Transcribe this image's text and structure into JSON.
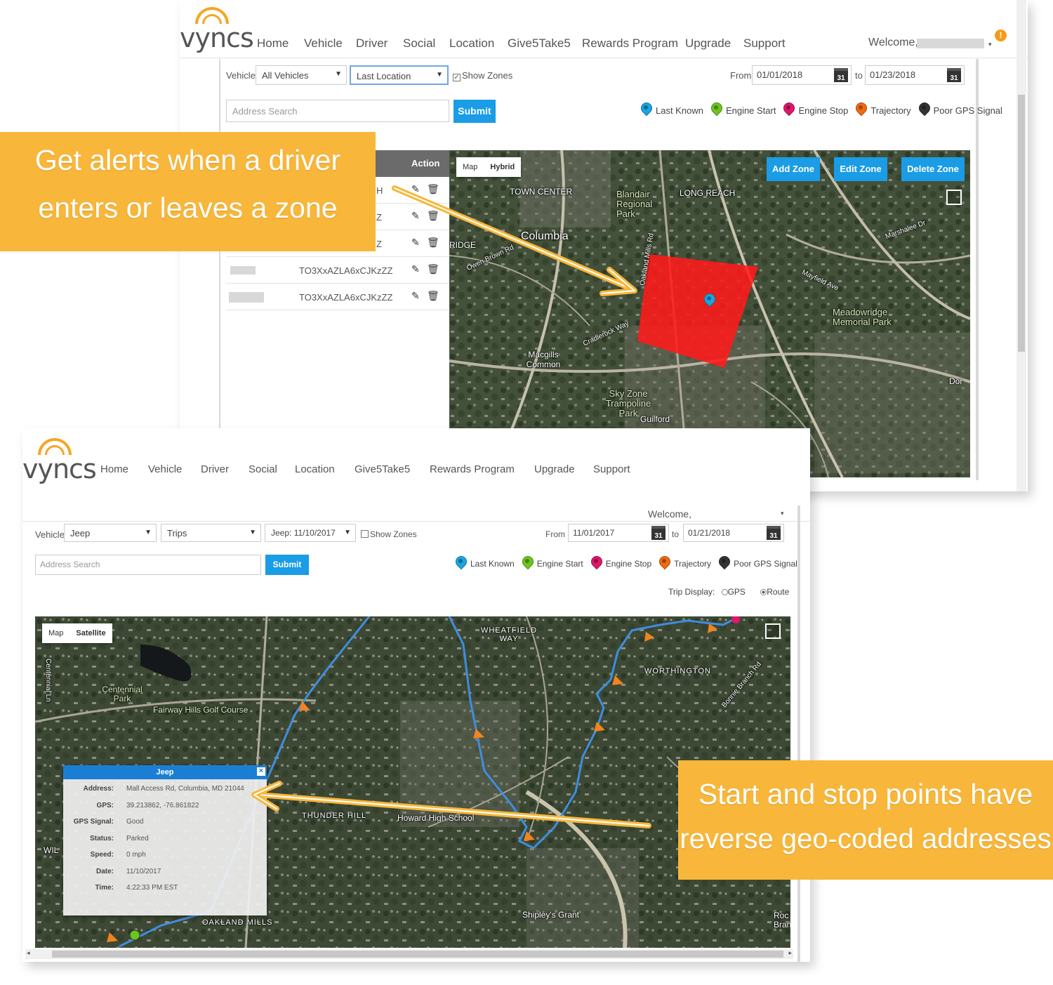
{
  "brand": {
    "logo_text": "vyncs",
    "accent": "#f5a623"
  },
  "nav": [
    "Home",
    "Vehicle",
    "Driver",
    "Social",
    "Location",
    "Give5Take5",
    "Rewards Program",
    "Upgrade",
    "Support"
  ],
  "screen1": {
    "welcome": "Welcome,",
    "notification_badge": "!",
    "vehicle_label": "Vehicle",
    "vehicle_select": "All Vehicles",
    "mode_select": "Last Location",
    "show_zones": "Show Zones",
    "from_label": "From",
    "from_date": "01/01/2018",
    "to_label": "to",
    "to_date": "01/23/2018",
    "cal_text": "31",
    "address_placeholder": "Address Search",
    "submit": "Submit",
    "legend": [
      {
        "label": "Last Known",
        "color": "#1aa5e0"
      },
      {
        "label": "Engine Start",
        "color": "#6cc51e"
      },
      {
        "label": "Engine Stop",
        "color": "#e0166b"
      },
      {
        "label": "Trajectory",
        "color": "#f26a10"
      },
      {
        "label": "Poor GPS Signal",
        "color": "#333333"
      }
    ],
    "table_action_header": "Action",
    "rows": [
      {
        "code": "TO3XxAZLA6xCJKzZZ"
      },
      {
        "code": "TO3XxAZLA6xCJKzZZ"
      }
    ],
    "row_fragments": [
      "H",
      "Z",
      "Z"
    ],
    "map_types": [
      "Map",
      "Hybrid"
    ],
    "zone_buttons": [
      "Add Zone",
      "Edit Zone",
      "Delete Zone"
    ],
    "map_labels": [
      "TOWN CENTER",
      "Columbia",
      "Blandair Regional Park",
      "LONG REACH",
      "RIDGE",
      "Macgills Common",
      "Sky Zone Trampoline Park",
      "Guilford",
      "Meadowridge Memorial Park",
      "Cradlerock Way",
      "Owen Brown Rd",
      "Oakland Mills Rd",
      "Marshalee Dr",
      "Mayfield Ave",
      "Dor"
    ]
  },
  "screen2": {
    "welcome": "Welcome,",
    "vehicle_label": "Vehicle",
    "vehicle_select": "Jeep",
    "mode_select": "Trips",
    "trip_select": "Jeep: 11/10/2017",
    "show_zones": "Show Zones",
    "from_label": "From",
    "from_date": "11/01/2017",
    "to_label": "to",
    "to_date": "01/21/2018",
    "cal_text": "31",
    "address_placeholder": "Address Search",
    "submit": "Submit",
    "legend": [
      {
        "label": "Last Known",
        "color": "#1aa5e0"
      },
      {
        "label": "Engine Start",
        "color": "#6cc51e"
      },
      {
        "label": "Engine Stop",
        "color": "#e0166b"
      },
      {
        "label": "Trajectory",
        "color": "#f26a10"
      },
      {
        "label": "Poor GPS Signal",
        "color": "#333333"
      }
    ],
    "trip_display_label": "Trip Display:",
    "trip_display_gps": "GPS",
    "trip_display_route": "Route",
    "map_types": [
      "Map",
      "Satellite"
    ],
    "map_labels": [
      "WHEATFIELD WAY",
      "WORTHINGTON",
      "Centennial Park",
      "Fairway Hills Golf Course",
      "THUNDER HILL",
      "Howard High School",
      "Shipley's Grant",
      "OAKLAND MILLS",
      "Centennial Ln",
      "Bonnie Branch Rd",
      "Roc Bran",
      "WIL"
    ],
    "popup": {
      "title": "Jeep",
      "close": "×",
      "fields": [
        {
          "k": "Address:",
          "v": "Mall Access Rd, Columbia, MD 21044"
        },
        {
          "k": "GPS:",
          "v": "39.213862, -76.861822"
        },
        {
          "k": "GPS Signal:",
          "v": "Good"
        },
        {
          "k": "Status:",
          "v": "Parked"
        },
        {
          "k": "Speed:",
          "v": "0 mph"
        },
        {
          "k": "Date:",
          "v": "11/10/2017"
        },
        {
          "k": "Time:",
          "v": "4:22:33 PM EST"
        }
      ]
    }
  },
  "callouts": {
    "zone_line1": "Get alerts when a driver",
    "zone_line2": "enters or leaves a zone",
    "geo_line1": "Start and stop points have",
    "geo_line2": "reverse geo-coded addresses",
    "color": "#f8b73a"
  }
}
